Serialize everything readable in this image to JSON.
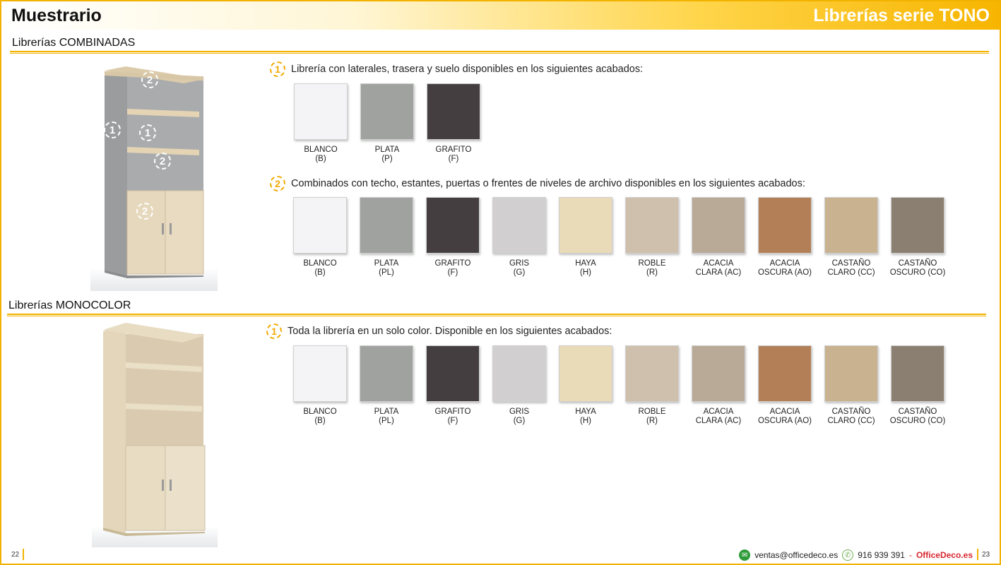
{
  "header": {
    "title": "Muestrario",
    "series": "Librerías serie TONO"
  },
  "colors": {
    "accent": "#f2b200",
    "badge": "#f2a900",
    "brand": "#d8262f"
  },
  "combinadas": {
    "title": "Librerías COMBINADAS",
    "markers": [
      "2",
      "1",
      "1",
      "2",
      "2"
    ],
    "step1": {
      "num": "1",
      "text": "Librería con laterales, trasera y suelo disponibles en los siguientes acabados:"
    },
    "swatches1": [
      {
        "name": "BLANCO",
        "code": "(B)",
        "color": "#f4f4f6"
      },
      {
        "name": "PLATA",
        "code": "(P)",
        "color": "#a0a2a0"
      },
      {
        "name": "GRAFITO",
        "code": "(F)",
        "color": "#443e40"
      }
    ],
    "step2": {
      "num": "2",
      "text": "Combinados con techo, estantes, puertas o frentes de niveles de archivo disponibles en los siguientes acabados:"
    },
    "swatches2": [
      {
        "name": "BLANCO",
        "code": "(B)",
        "color": "#f4f4f6"
      },
      {
        "name": "PLATA",
        "code": "(PL)",
        "color": "#a0a2a0"
      },
      {
        "name": "GRAFITO",
        "code": "(F)",
        "color": "#443e40"
      },
      {
        "name": "GRIS",
        "code": "(G)",
        "color": "#d2cfd0"
      },
      {
        "name": "HAYA",
        "code": "(H)",
        "color": "#e9dab8"
      },
      {
        "name": "ROBLE",
        "code": "(R)",
        "color": "#cfc0ad"
      },
      {
        "name": "ACACIA",
        "code": "CLARA (AC)",
        "color": "#b9aa98"
      },
      {
        "name": "ACACIA",
        "code": "OSCURA (AO)",
        "color": "#b27f57"
      },
      {
        "name": "CASTAÑO",
        "code": "CLARO (CC)",
        "color": "#c8b290"
      },
      {
        "name": "CASTAÑO",
        "code": "OSCURO (CO)",
        "color": "#8a7f70"
      }
    ]
  },
  "monocolor": {
    "title": "Librerías MONOCOLOR",
    "step1": {
      "num": "1",
      "text": "Toda la librería en un solo color. Disponible en los siguientes acabados:"
    },
    "swatches": [
      {
        "name": "BLANCO",
        "code": "(B)",
        "color": "#f4f4f6"
      },
      {
        "name": "PLATA",
        "code": "(PL)",
        "color": "#a0a2a0"
      },
      {
        "name": "GRAFITO",
        "code": "(F)",
        "color": "#443e40"
      },
      {
        "name": "GRIS",
        "code": "(G)",
        "color": "#d2cfd0"
      },
      {
        "name": "HAYA",
        "code": "(H)",
        "color": "#e9dab8"
      },
      {
        "name": "ROBLE",
        "code": "(R)",
        "color": "#cfc0ad"
      },
      {
        "name": "ACACIA",
        "code": "CLARA (AC)",
        "color": "#b9aa98"
      },
      {
        "name": "ACACIA",
        "code": "OSCURA (AO)",
        "color": "#b27f57"
      },
      {
        "name": "CASTAÑO",
        "code": "CLARO (CC)",
        "color": "#c8b290"
      },
      {
        "name": "CASTAÑO",
        "code": "OSCURO (CO)",
        "color": "#8a7f70"
      }
    ]
  },
  "footer": {
    "page_left": "22",
    "page_right": "23",
    "email": "ventas@officedeco.es",
    "phone": "916 939 391",
    "separator": "-",
    "brand": "OfficeDeco.es",
    "icons": {
      "email": "mail-icon",
      "phone": "phone-icon"
    }
  }
}
